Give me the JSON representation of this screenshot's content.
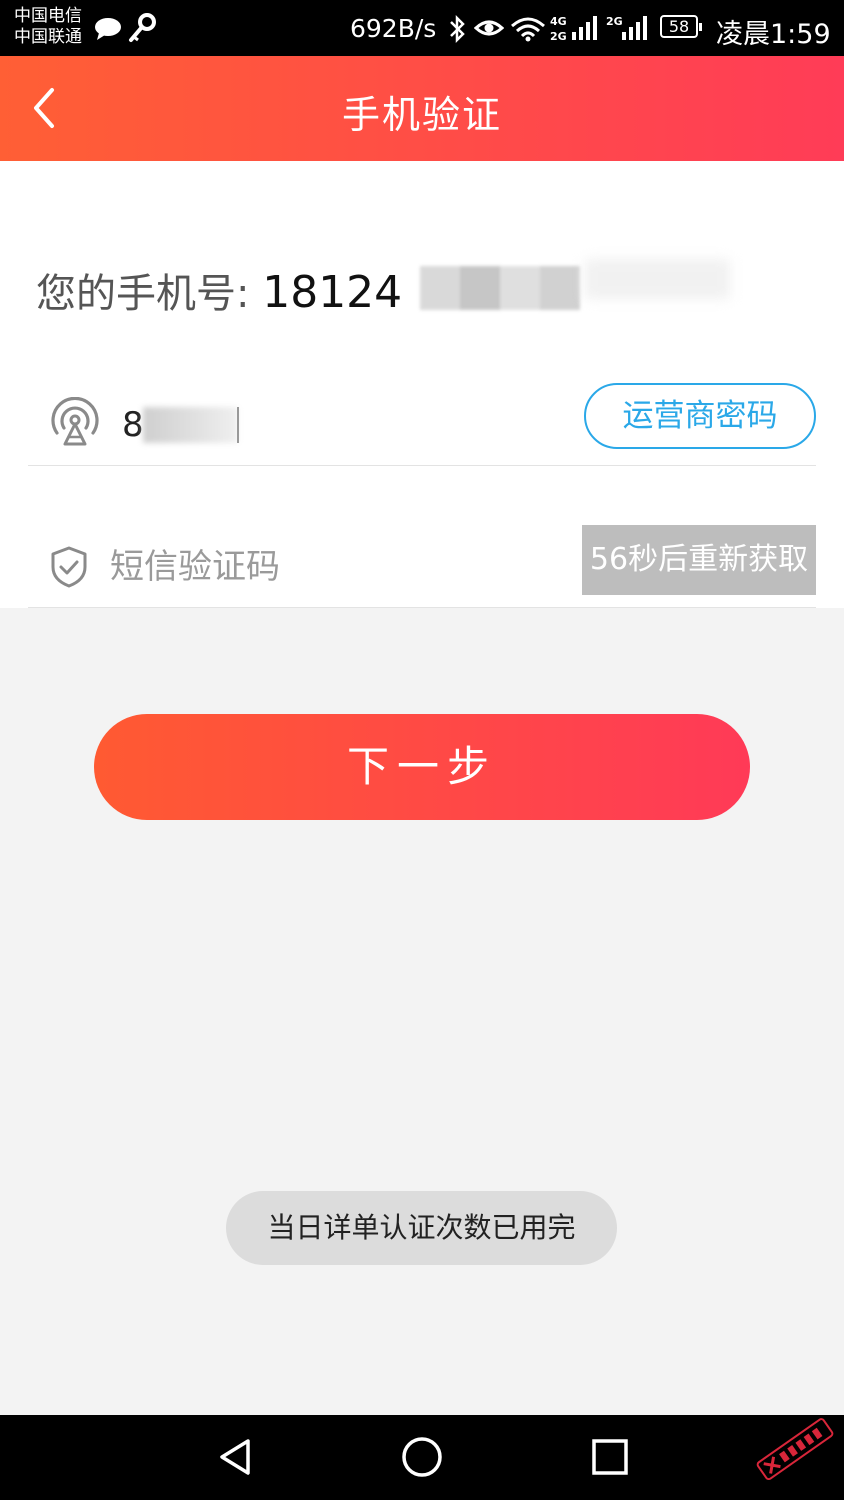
{
  "status_bar": {
    "carrier_1": "中国电信",
    "carrier_2": "中国联通",
    "net_speed": "692B/s",
    "network_1": "4G",
    "network_2": "2G",
    "battery": "58",
    "time": "凌晨1:59"
  },
  "header": {
    "title": "手机验证",
    "back_icon": "chevron-left-icon"
  },
  "form": {
    "phone_label": "您的手机号:",
    "phone_number_visible": "18124",
    "carrier_password_value": "8",
    "carrier_password_button": "运营商密码",
    "sms_placeholder": "短信验证码",
    "resend_label": "56秒后重新获取"
  },
  "next_button": "下一步",
  "toast": "当日详单认证次数已用完",
  "nav": {
    "back": "triangle-back-icon",
    "home": "circle-home-icon",
    "recents": "square-recents-icon"
  },
  "colors": {
    "header_start": "#ff5f35",
    "header_end": "#ff3c57",
    "accent_blue": "#2aa8e8",
    "disabled_gray": "#bdbdbd"
  }
}
